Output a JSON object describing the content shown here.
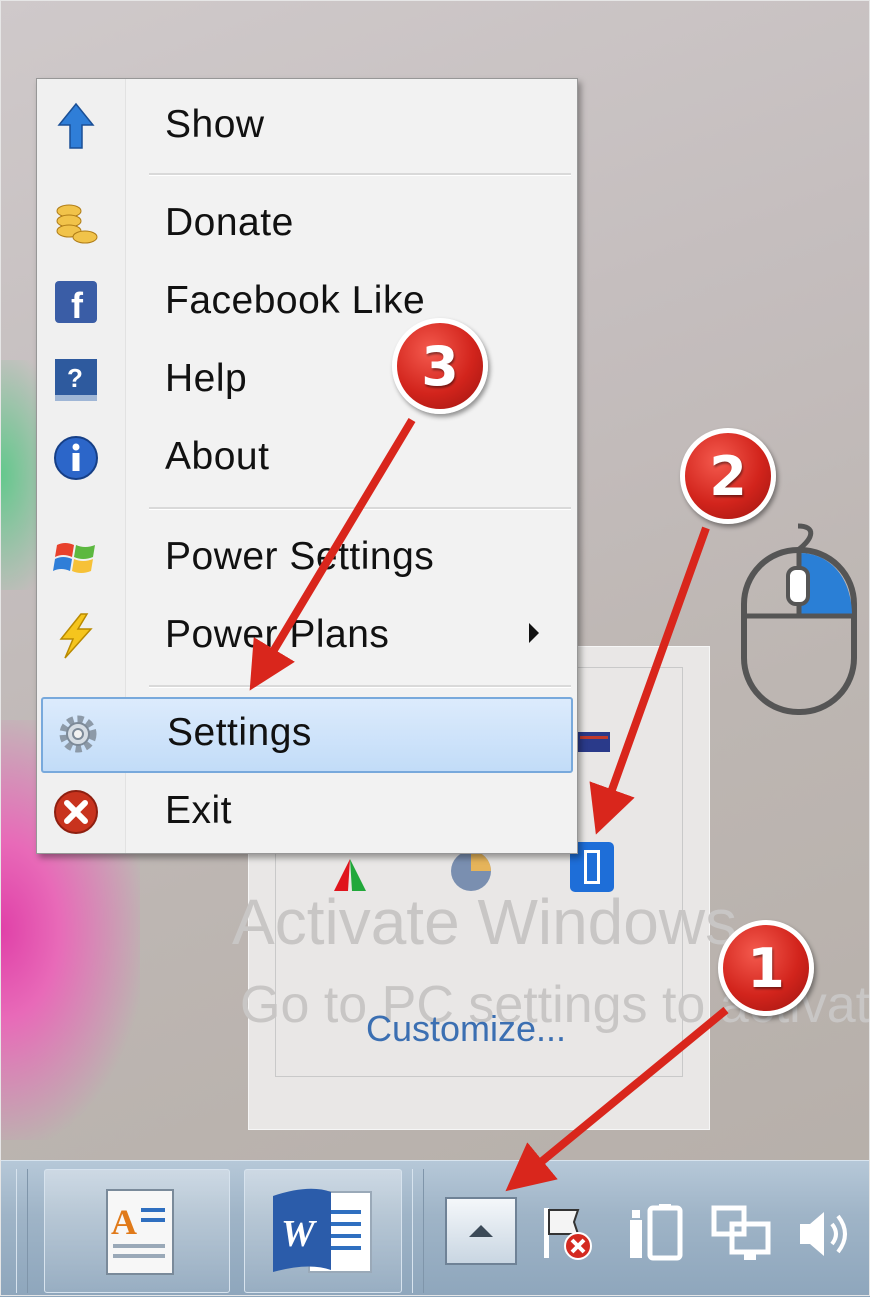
{
  "overflow_panel": {
    "watermark_line1": "Activate Windows",
    "watermark_line2": "Go to PC settings to activate",
    "customize_link": "Customize..."
  },
  "context_menu": {
    "items": [
      {
        "label": "Show",
        "icon": "up-arrow-icon"
      },
      {
        "label": "Donate",
        "icon": "coins-icon"
      },
      {
        "label": "Facebook Like",
        "icon": "facebook-icon"
      },
      {
        "label": "Help",
        "icon": "help-book-icon"
      },
      {
        "label": "About",
        "icon": "info-icon"
      },
      {
        "label": "Power Settings",
        "icon": "windows-flag-icon"
      },
      {
        "label": "Power Plans",
        "icon": "lightning-icon"
      },
      {
        "label": "Settings",
        "icon": "gear-icon"
      },
      {
        "label": "Exit",
        "icon": "close-circle-icon"
      }
    ]
  },
  "annotations": {
    "step1": "1",
    "step2": "2",
    "step3": "3",
    "arrow_color": "#d9261c"
  },
  "taskbar": {
    "pinned": [
      "word-document-app-icon",
      "word-app-icon"
    ],
    "tray": [
      "show-hidden-icons-button",
      "action-center-flag-icon",
      "battery-icon",
      "network-icon",
      "volume-icon"
    ]
  }
}
